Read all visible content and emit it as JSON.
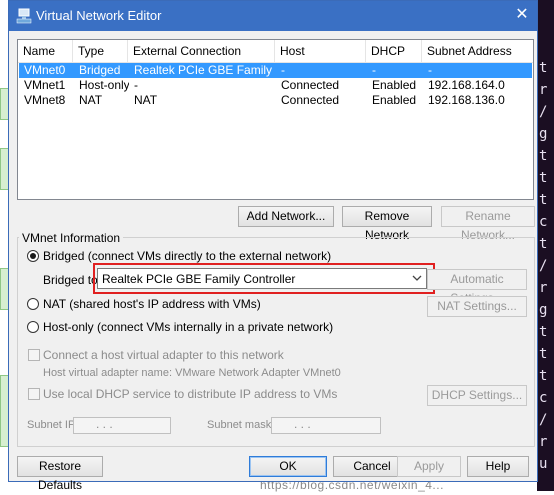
{
  "window": {
    "title": "Virtual Network Editor",
    "close_glyph": "✕",
    "title_icon": "vmware-network-icon"
  },
  "table": {
    "columns": [
      "Name",
      "Type",
      "External Connection",
      "Host Connection",
      "DHCP",
      "Subnet Address"
    ],
    "rows": [
      [
        "VMnet0",
        "Bridged",
        "Realtek PCIe GBE Family Co...",
        "-",
        "-",
        "-"
      ],
      [
        "VMnet1",
        "Host-only",
        "-",
        "Connected",
        "Enabled",
        "192.168.164.0"
      ],
      [
        "VMnet8",
        "NAT",
        "NAT",
        "Connected",
        "Enabled",
        "192.168.136.0"
      ]
    ],
    "selected_row": 0
  },
  "actions": {
    "add_network": "Add Network...",
    "remove_network": "Remove Network",
    "rename_network": "Rename Network..."
  },
  "vmnet_info": {
    "group_title": "VMnet Information",
    "bridged_label": "Bridged (connect VMs directly to the external network)",
    "bridged_to_label": "Bridged to:",
    "bridged_to_value": "Realtek PCIe GBE Family Controller",
    "automatic_settings": "Automatic Settings...",
    "nat_label": "NAT (shared host's IP address with VMs)",
    "nat_settings": "NAT Settings...",
    "hostonly_label": "Host-only (connect VMs internally in a private network)",
    "connect_adapter_label": "Connect a host virtual adapter to this network",
    "adapter_name_label": "Host virtual adapter name: VMware Network Adapter VMnet0",
    "dhcp_label": "Use local DHCP service to distribute IP address to VMs",
    "dhcp_settings": "DHCP Settings...",
    "subnet_ip_label": "Subnet IP:",
    "subnet_mask_label": "Subnet mask:",
    "ip_placeholder": ".       .       .",
    "selected_mode": "bridged",
    "highlight_color": "#e02020"
  },
  "footer": {
    "restore_defaults": "Restore Defaults",
    "ok": "OK",
    "cancel": "Cancel",
    "apply": "Apply",
    "help": "Help"
  },
  "background": {
    "watermark": "https://blog.csdn.net/weixin_4...",
    "right_glyphs": [
      "t",
      "r",
      "/",
      "g",
      "t",
      "t",
      "t",
      "c",
      "t",
      "/",
      "r",
      "g",
      "t",
      "t",
      "t",
      "c",
      "/",
      "r",
      "u"
    ]
  }
}
